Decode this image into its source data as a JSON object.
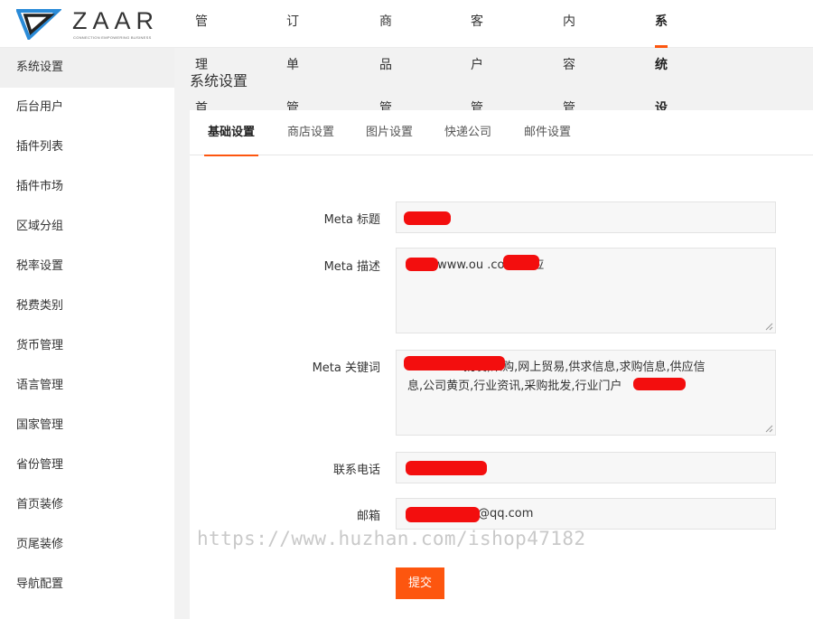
{
  "brand": {
    "name": "ZAAR",
    "tagline": "CONNECTION EMPOWERING BUSINESS",
    "accent": "#fd560f"
  },
  "topnav": [
    {
      "label": "管理首页"
    },
    {
      "label": "订单管理"
    },
    {
      "label": "商品管理"
    },
    {
      "label": "客户管理"
    },
    {
      "label": "内容管理"
    },
    {
      "label": "系统设置",
      "active": true
    }
  ],
  "sidebar": [
    {
      "label": "系统设置",
      "active": true
    },
    {
      "label": "后台用户"
    },
    {
      "label": "插件列表"
    },
    {
      "label": "插件市场"
    },
    {
      "label": "区域分组"
    },
    {
      "label": "税率设置"
    },
    {
      "label": "税费类别"
    },
    {
      "label": "货币管理"
    },
    {
      "label": "语言管理"
    },
    {
      "label": "国家管理"
    },
    {
      "label": "省份管理"
    },
    {
      "label": "首页装修"
    },
    {
      "label": "页尾装修"
    },
    {
      "label": "导航配置"
    }
  ],
  "page_title": "系统设置",
  "tabs": [
    {
      "label": "基础设置",
      "active": true
    },
    {
      "label": "商店设置"
    },
    {
      "label": "图片设置"
    },
    {
      "label": "快递公司"
    },
    {
      "label": "邮件设置"
    }
  ],
  "form": {
    "meta_title": {
      "label": "Meta 标题",
      "value": ""
    },
    "meta_description": {
      "label": "Meta 描述",
      "value": "(www.ou      .com)供应"
    },
    "meta_keywords": {
      "label": "Meta 关键词",
      "value_line1": "               批发,采购,网上贸易,供求信息,求购信息,供应信",
      "value_line2": "息,公司黄页,行业资讯,采购批发,行业门户"
    },
    "phone": {
      "label": "联系电话",
      "value": ""
    },
    "email": {
      "label": "邮箱",
      "value": "@qq.com"
    },
    "submit_label": "提交"
  },
  "watermark": "https://www.huzhan.com/ishop47182"
}
